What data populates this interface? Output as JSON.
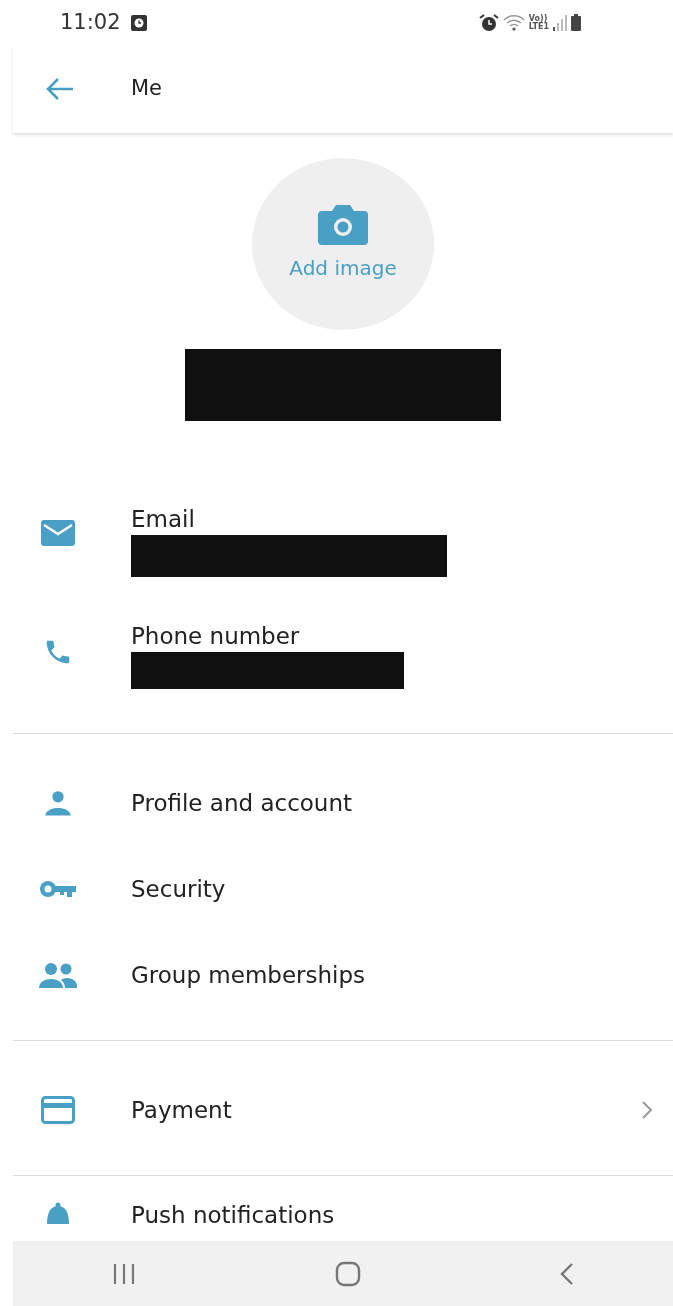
{
  "status_bar": {
    "time": "11:02",
    "network_lines": [
      "Vo))",
      "LTE1"
    ]
  },
  "app_bar": {
    "title": "Me"
  },
  "avatar": {
    "label": "Add image"
  },
  "profile_name": {
    "redacted": true
  },
  "contacts": [
    {
      "kind": "email",
      "label": "Email",
      "redacted": true
    },
    {
      "kind": "phone",
      "label": "Phone number",
      "redacted": true
    }
  ],
  "sections": [
    {
      "items": [
        {
          "kind": "person",
          "label": "Profile and account",
          "chevron": false
        },
        {
          "kind": "key",
          "label": "Security",
          "chevron": false
        },
        {
          "kind": "group",
          "label": "Group memberships",
          "chevron": false
        }
      ]
    },
    {
      "items": [
        {
          "kind": "card",
          "label": "Payment",
          "chevron": true
        }
      ]
    },
    {
      "items": [
        {
          "kind": "bell",
          "label": "Push notifications",
          "chevron": false
        }
      ]
    }
  ]
}
